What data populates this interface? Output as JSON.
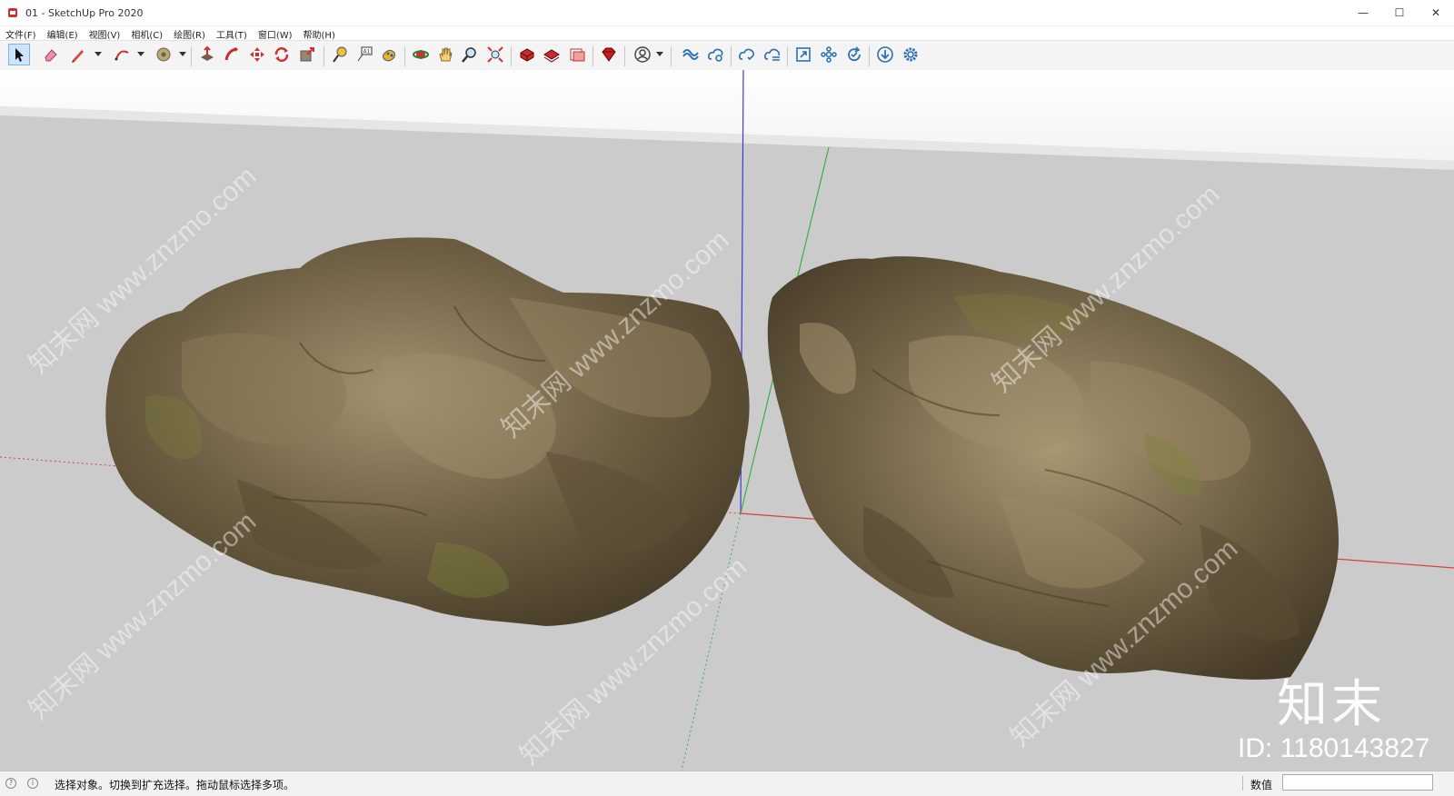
{
  "window": {
    "title": "01 - SketchUp Pro 2020",
    "minimize_glyph": "—",
    "maximize_glyph": "☐",
    "close_glyph": "✕"
  },
  "menu": [
    "文件(F)",
    "编辑(E)",
    "视图(V)",
    "相机(C)",
    "绘图(R)",
    "工具(T)",
    "窗口(W)",
    "帮助(H)"
  ],
  "toolbar": {
    "items": [
      "select-icon",
      "eraser-icon",
      "pencil-icon",
      "arc-icon",
      "paint-bucket-icon",
      "push-pull-icon",
      "follow-me-icon",
      "move-icon",
      "rotate-icon",
      "scale-icon",
      "tape-measure-icon",
      "text-label-icon",
      "paint-icon",
      "orbit-icon",
      "pan-icon",
      "zoom-icon",
      "zoom-extents-icon",
      "3d-warehouse-icon",
      "extension-warehouse-icon",
      "layout-icon",
      "ruby-icon",
      "account-icon",
      "trimble-connect-icon",
      "cloud-upload-icon",
      "cloud-sync-icon",
      "cloud-list-icon",
      "expand-icon",
      "components-icon",
      "refresh-icon",
      "download-icon",
      "settings-icon"
    ]
  },
  "viewport": {
    "background": "#cbcbcb",
    "sky": "#ffffff",
    "watermark": "知末网 www.znzmo.com",
    "logo": "知末",
    "id_label": "ID: 1180143827"
  },
  "status": {
    "message": "选择对象。切换到扩充选择。拖动鼠标选择多项。",
    "measure_label": "数值",
    "measure_value": ""
  },
  "colors": {
    "rock_base": "#6b5d3f",
    "rock_light": "#9b8a66",
    "moss": "#7d8238",
    "axis_red": "#d94040",
    "axis_green": "#3fae3f",
    "axis_blue": "#3a3ad8"
  }
}
